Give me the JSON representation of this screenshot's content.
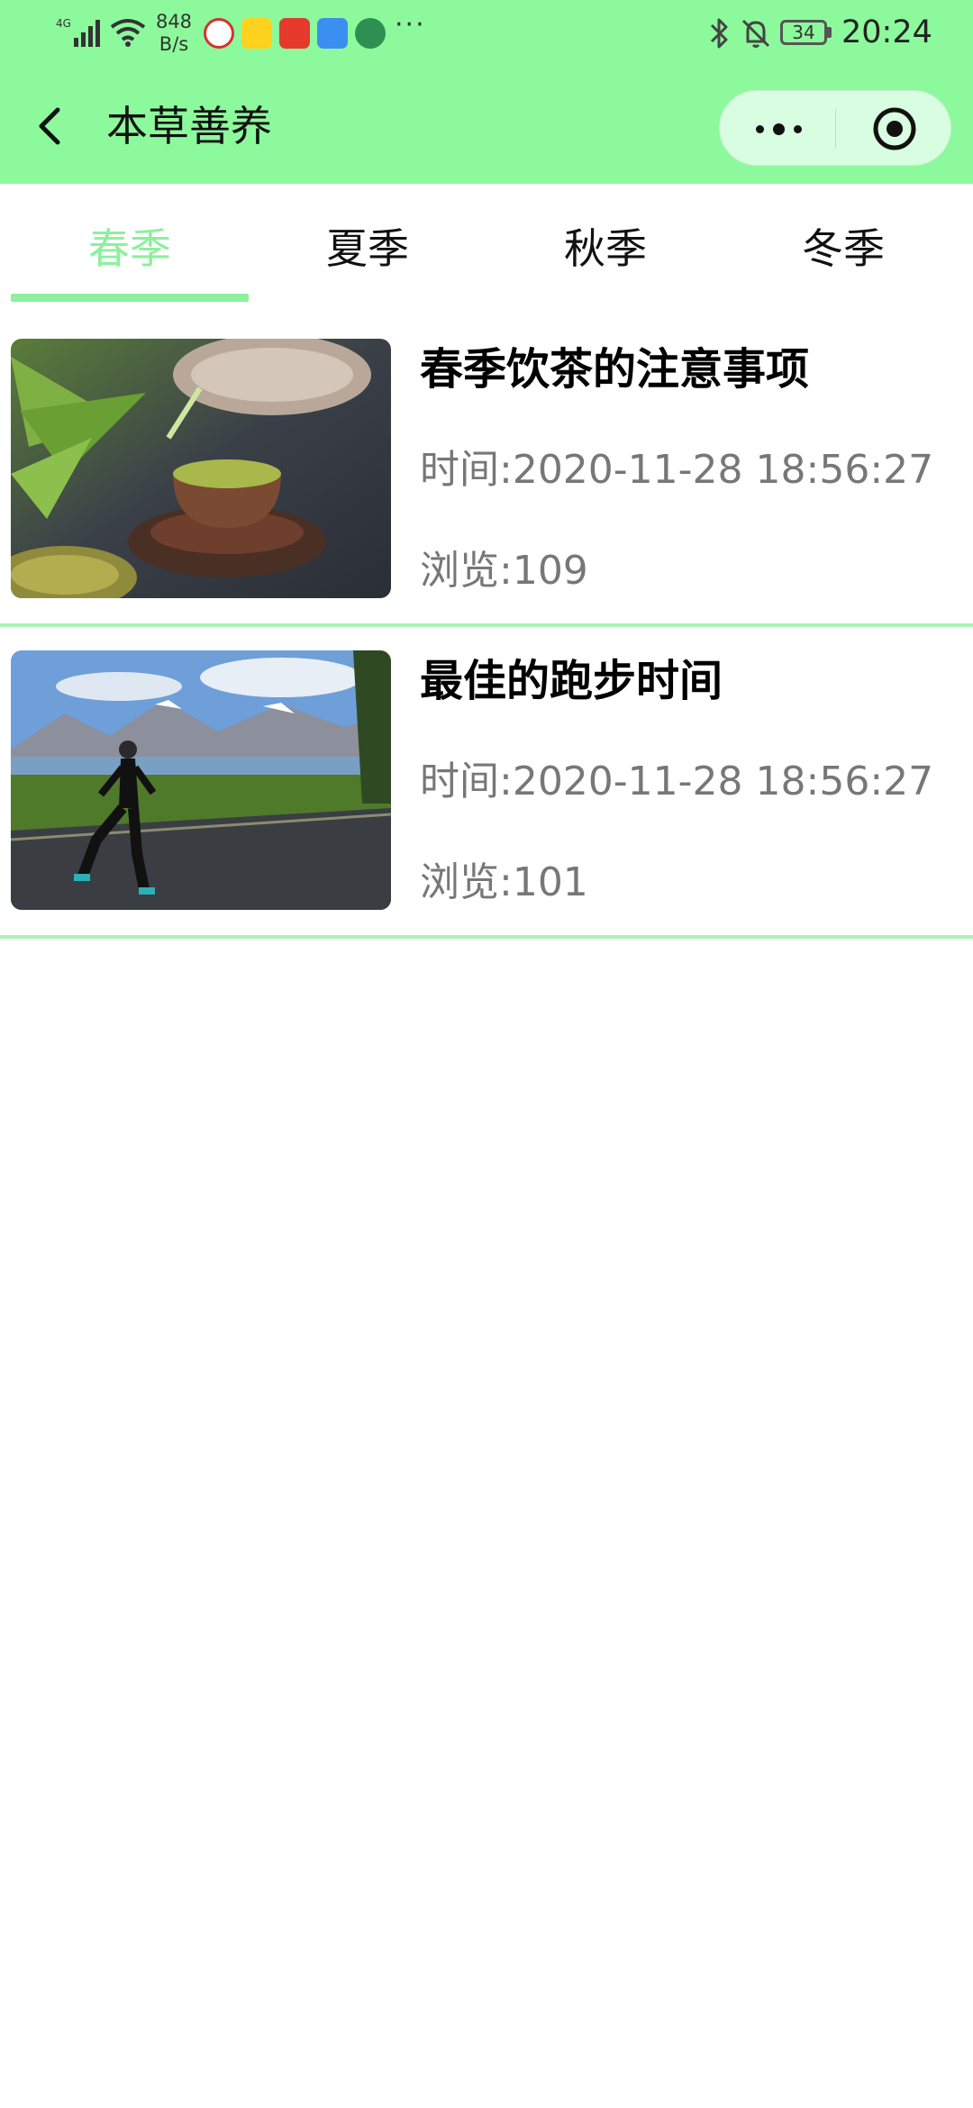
{
  "status_bar": {
    "network": "4G",
    "speed": "848\nB/s",
    "speed_value": "848",
    "speed_unit": "B/s",
    "overflow": "···",
    "battery": "34",
    "time": "20:24"
  },
  "nav": {
    "title": "本草善养"
  },
  "tabs": [
    {
      "label": "春季",
      "active": true
    },
    {
      "label": "夏季",
      "active": false
    },
    {
      "label": "秋季",
      "active": false
    },
    {
      "label": "冬季",
      "active": false
    }
  ],
  "articles": [
    {
      "title": "春季饮茶的注意事项",
      "time": "时间:2020-11-28 18:56:27",
      "views": "浏览:109",
      "image": "tea-pouring-photo"
    },
    {
      "title": "最佳的跑步时间",
      "time": "时间:2020-11-28 18:56:27",
      "views": "浏览:101",
      "image": "runner-mountain-photo"
    }
  ],
  "colors": {
    "header": "#8cfa9c",
    "accent": "#8cf09c",
    "divider": "#a9f3b4"
  }
}
